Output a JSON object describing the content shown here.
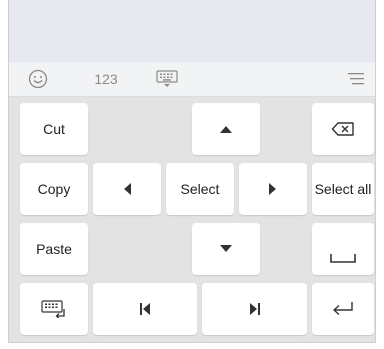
{
  "toolbar": {
    "emoji_icon": "smiley-face-icon",
    "numbers_label": "123",
    "keyboard_icon": "keyboard-hide-icon",
    "menu_icon": "menu-icon"
  },
  "keys": {
    "cut": "Cut",
    "copy": "Copy",
    "paste": "Paste",
    "select": "Select",
    "select_all": "Select all",
    "up_icon": "arrow-up-icon",
    "down_icon": "arrow-down-icon",
    "left_icon": "arrow-left-icon",
    "right_icon": "arrow-right-icon",
    "backspace_icon": "backspace-icon",
    "space_icon": "space-icon",
    "enter_icon": "enter-icon",
    "keyboard_switch_icon": "keyboard-return-icon",
    "home_icon": "skip-start-icon",
    "end_icon": "skip-end-icon"
  }
}
